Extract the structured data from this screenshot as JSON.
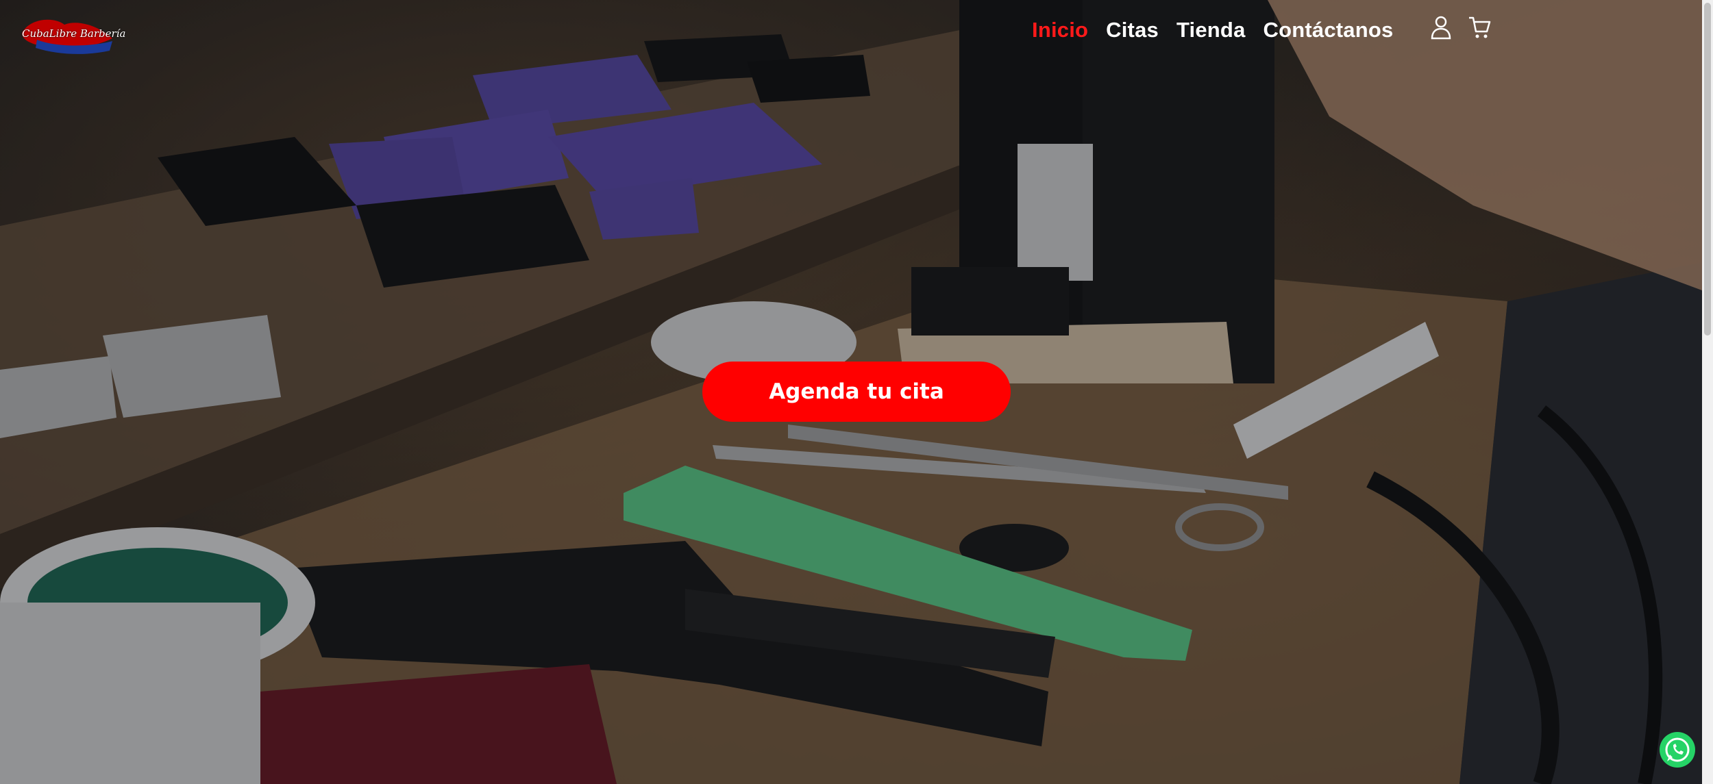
{
  "brand": {
    "logo_text": "CubaLibre Barbería"
  },
  "nav": {
    "items": [
      {
        "label": "Inicio",
        "active": true
      },
      {
        "label": "Citas",
        "active": false
      },
      {
        "label": "Tienda",
        "active": false
      },
      {
        "label": "Contáctanos",
        "active": false
      }
    ]
  },
  "header_icons": [
    "user-icon",
    "cart-icon"
  ],
  "hero": {
    "cta_label": "Agenda tu cita"
  },
  "floating": {
    "icon": "whatsapp-icon"
  },
  "colors": {
    "accent": "#ff0000",
    "active_nav": "#ff1a1a",
    "whatsapp": "#25d366"
  }
}
